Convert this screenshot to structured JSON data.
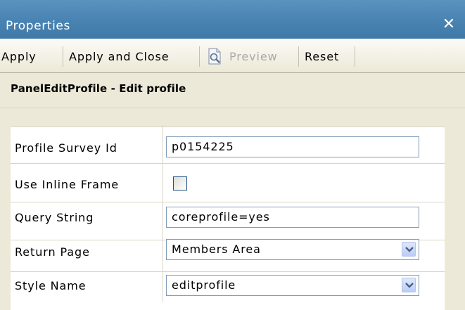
{
  "window": {
    "title": "Properties",
    "close_glyph": "✕"
  },
  "toolbar": {
    "apply": "Apply",
    "apply_and_close": "Apply and Close",
    "preview": "Preview",
    "reset": "Reset",
    "preview_icon": "document-magnifier-icon"
  },
  "header": {
    "title": "PanelEditProfile - Edit profile"
  },
  "fields": {
    "profile_survey_id": {
      "label": "Profile Survey Id",
      "value": "p0154225"
    },
    "use_inline_frame": {
      "label": "Use Inline Frame",
      "checked": false
    },
    "query_string": {
      "label": "Query String",
      "value": "coreprofile=yes"
    },
    "return_page": {
      "label": "Return Page",
      "value": "Members Area"
    },
    "style_name": {
      "label": "Style Name",
      "value": "editprofile"
    }
  },
  "colors": {
    "titlebar": "#4a84b3",
    "background": "#ece9d8",
    "input_border": "#7f9db9"
  }
}
